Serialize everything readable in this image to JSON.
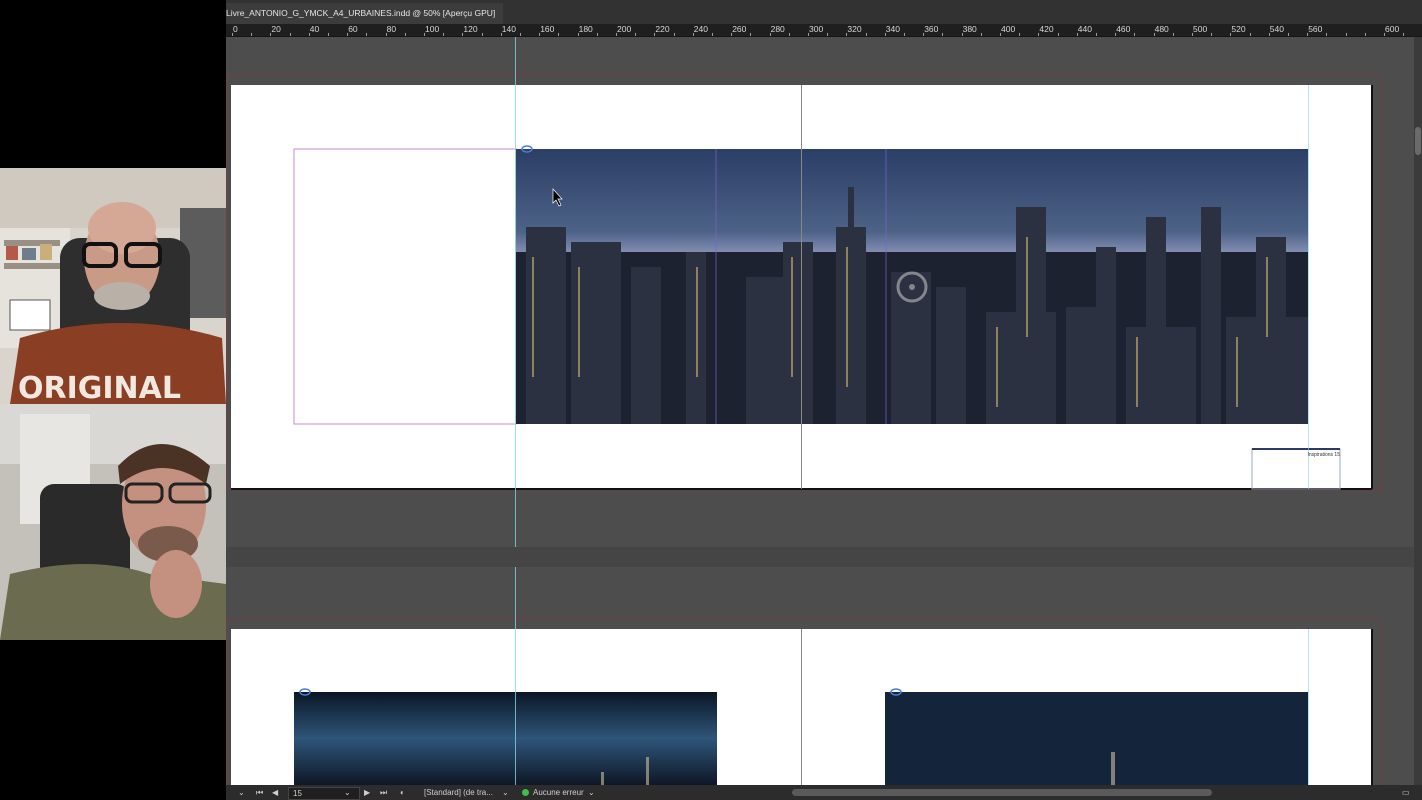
{
  "document_tab": "Livre_ANTONIO_G_YMCK_A4_URBAINES.indd @ 50% [Aperçu GPU]",
  "ruler_labels": [
    "0",
    "20",
    "40",
    "60",
    "80",
    "100",
    "120",
    "140",
    "160",
    "180",
    "200",
    "220",
    "240",
    "260",
    "280",
    "300",
    "320",
    "340",
    "360",
    "380",
    "400",
    "420",
    "440",
    "460",
    "480",
    "500",
    "520",
    "540",
    "560",
    "600"
  ],
  "page_footer_text": "Inspirations 15",
  "statusbar": {
    "page_number": "15",
    "profile": "[Standard] (de tra...",
    "preflight": "Aucune erreur"
  },
  "colors": {
    "accent_green": "#3ec04a",
    "guide_cyan": "#7fd6e6",
    "frame_magenta": "#c88ad6"
  }
}
